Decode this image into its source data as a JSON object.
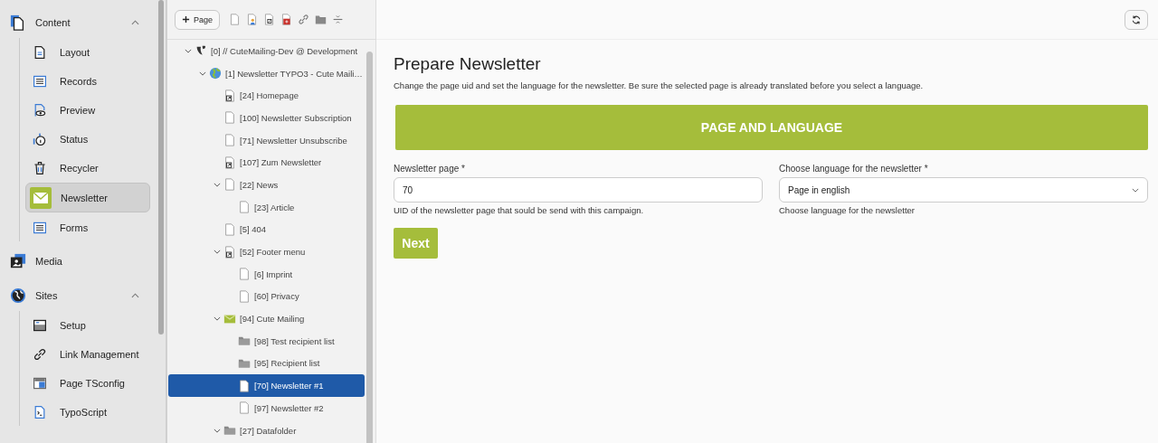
{
  "modules": [
    {
      "label": "Content",
      "expanded": true,
      "children": [
        {
          "label": "Layout",
          "selected": false
        },
        {
          "label": "Records",
          "selected": false
        },
        {
          "label": "Preview",
          "selected": false
        },
        {
          "label": "Status",
          "selected": false
        },
        {
          "label": "Recycler",
          "selected": false
        },
        {
          "label": "Newsletter",
          "selected": true
        },
        {
          "label": "Forms",
          "selected": false
        }
      ]
    },
    {
      "label": "Media"
    },
    {
      "label": "Sites",
      "expanded": true,
      "children": [
        {
          "label": "Setup",
          "selected": false
        },
        {
          "label": "Link Management",
          "selected": false
        },
        {
          "label": "Page TSconfig",
          "selected": false
        },
        {
          "label": "TypoScript",
          "selected": false
        }
      ]
    }
  ],
  "toolbar": {
    "new_page_button": "Page"
  },
  "tree": [
    {
      "label": "[0] // CuteMailing-Dev @ Development",
      "kind": "root",
      "selected": false,
      "expanded": true,
      "children": [
        {
          "label": "[1] Newsletter TYPO3 - Cute Maili…",
          "kind": "site",
          "selected": false,
          "expanded": true,
          "children": [
            {
              "label": "[24] Homepage",
              "kind": "shortcut",
              "selected": false
            },
            {
              "label": "[100] Newsletter Subscription",
              "kind": "page",
              "selected": false
            },
            {
              "label": "[71] Newsletter Unsubscribe",
              "kind": "page",
              "selected": false
            },
            {
              "label": "[107] Zum Newsletter",
              "kind": "shortcut",
              "selected": false
            },
            {
              "label": "[22] News",
              "kind": "page",
              "selected": false,
              "expanded": true,
              "children": [
                {
                  "label": "[23] Article",
                  "kind": "page",
                  "selected": false
                }
              ]
            },
            {
              "label": "[5] 404",
              "kind": "page",
              "selected": false
            },
            {
              "label": "[52] Footer menu",
              "kind": "shortcut",
              "selected": false,
              "expanded": true,
              "children": [
                {
                  "label": "[6] Imprint",
                  "kind": "page",
                  "selected": false
                },
                {
                  "label": "[60] Privacy",
                  "kind": "page",
                  "selected": false
                }
              ]
            },
            {
              "label": "[94] Cute Mailing",
              "kind": "mailing",
              "selected": false,
              "expanded": true,
              "children": [
                {
                  "label": "[98] Test recipient list",
                  "kind": "folder",
                  "selected": false
                },
                {
                  "label": "[95] Recipient list",
                  "kind": "folder",
                  "selected": false
                },
                {
                  "label": "[70] Newsletter #1",
                  "kind": "page",
                  "selected": true
                },
                {
                  "label": "[97] Newsletter #2",
                  "kind": "page",
                  "selected": false
                }
              ]
            },
            {
              "label": "[27] Datafolder",
              "kind": "folder",
              "selected": false,
              "expanded": true
            }
          ]
        }
      ]
    }
  ],
  "main": {
    "title": "Prepare Newsletter",
    "description": "Change the page uid and set the language for the newsletter. Be sure the selected page is already translated before you select a language.",
    "section_title": "PAGE AND LANGUAGE",
    "fields": [
      {
        "kind": "input",
        "label": "Newsletter page *",
        "value": "70",
        "help": "UID of the newsletter page that sould be send with this campaign."
      },
      {
        "kind": "select",
        "label": "Choose language for the newsletter *",
        "value": "Page in english",
        "help": "Choose language for the newsletter"
      }
    ],
    "next_button": "Next"
  }
}
